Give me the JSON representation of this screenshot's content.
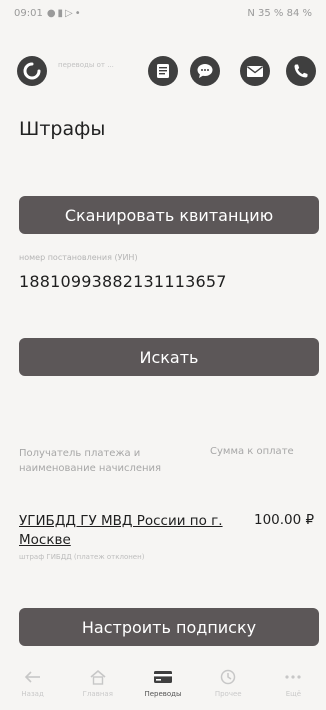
{
  "status_bar": {
    "time": "09:01",
    "right": "N 35 % 84 %"
  },
  "header": {
    "logo_subtitle": "переводы от ..."
  },
  "page": {
    "title": "Штрафы"
  },
  "scan_button": {
    "label": "Сканировать квитанцию"
  },
  "resolution_field": {
    "label": "номер постановления (УИН)",
    "value": "18810993882131113657"
  },
  "search_button": {
    "label": "Искать"
  },
  "results": {
    "col_recipient": "Получатель платежа и наименование начисления",
    "col_amount": "Сумма к оплате",
    "row": {
      "recipient": "УГИБДД ГУ МВД России по г. Москве",
      "amount": "100.00 ₽",
      "note": "штраф ГИБДД (платеж отклонен)"
    }
  },
  "subscribe_button": {
    "label": "Настроить подписку"
  },
  "bottom_nav": [
    {
      "label": "Назад",
      "icon": "back-icon"
    },
    {
      "label": "Главная",
      "icon": "home-icon"
    },
    {
      "label": "Переводы",
      "icon": "transfers-icon",
      "active": true
    },
    {
      "label": "Прочее",
      "icon": "other-icon"
    },
    {
      "label": "Ещё",
      "icon": "more-icon"
    }
  ],
  "colors": {
    "button": "#5c5758",
    "icon_dark": "#3f3f3f",
    "background": "#f6f5f3"
  }
}
